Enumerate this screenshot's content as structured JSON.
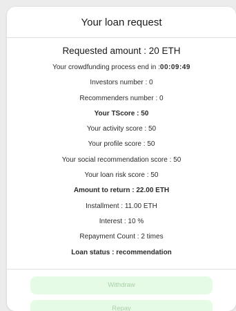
{
  "title": "Your loan request",
  "requested_amount": "Requested amount : 20 ETH",
  "crowdfunding": {
    "prefix": "Your crowdfunding process end in :",
    "timer": "00:09:49"
  },
  "investors": "Investors number : 0",
  "recommenders": "Recommenders number : 0",
  "tscore": "Your TScore : 50",
  "activity_score": "Your activity score : 50",
  "profile_score": "Your profile score : 50",
  "social_score": "Your social recommendation score : 50",
  "risk_score": "Your loan risk score : 50",
  "amount_to_return": "Amount to return : 22.00 ETH",
  "installment": "Installment : 11.00 ETH",
  "interest": "Interest : 10 %",
  "repayment_count": "Repayment Count : 2 times",
  "loan_status": "Loan status : recommendation",
  "buttons": {
    "withdraw": "Withdraw",
    "repay": "Repay"
  },
  "colors": {
    "button_bg": "#e6fbe6",
    "button_text": "#a9cfa9"
  }
}
